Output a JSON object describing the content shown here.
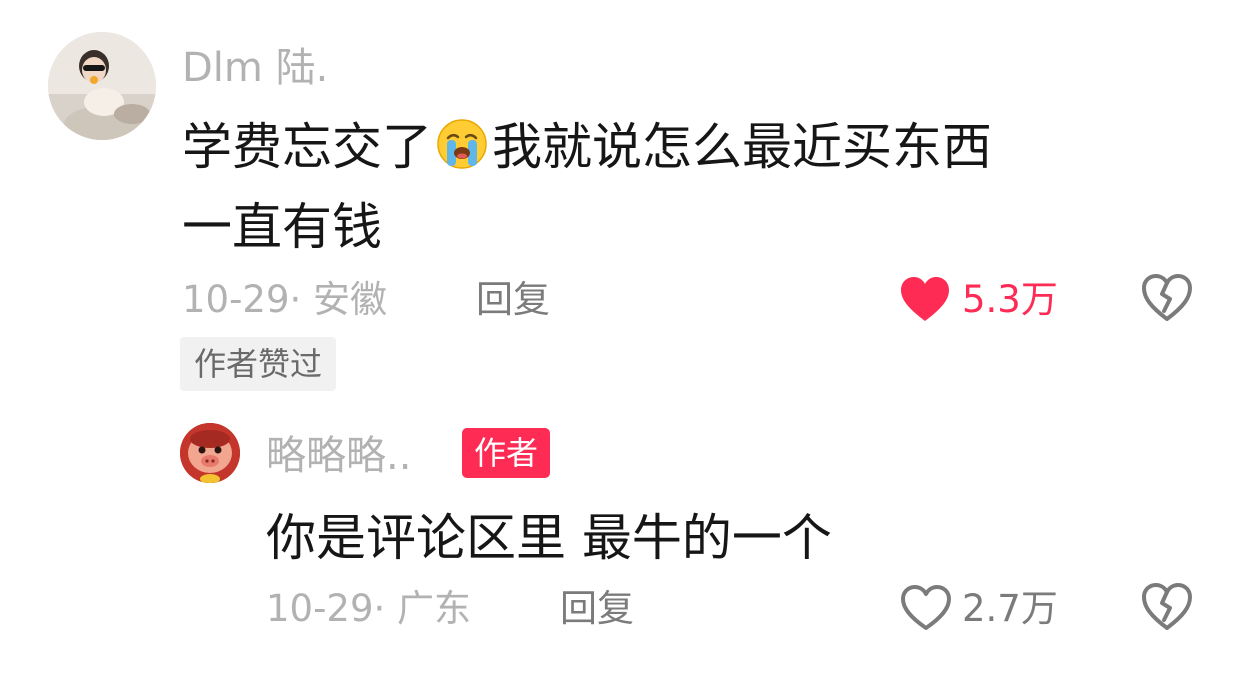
{
  "colors": {
    "accent": "#fe2c55",
    "muted_text": "#b2b2b2",
    "main_text": "#161616",
    "icon_gray": "#7b7b7b"
  },
  "comment": {
    "username": "Dlm 陆.",
    "text_part1": "学费忘交了",
    "emoji": "loudly-crying-face",
    "text_part2": "我就说怎么最近买东西",
    "text_line2": "一直有钱",
    "meta": "10-29· 安徽",
    "reply_label": "回复",
    "like_count": "5.3万",
    "liked": true,
    "author_liked_badge": "作者赞过"
  },
  "reply": {
    "username": "略略略..",
    "author_tag": "作者",
    "text": "你是评论区里 最牛的一个",
    "meta": "10-29· 广东",
    "reply_label": "回复",
    "like_count": "2.7万",
    "liked": false
  }
}
